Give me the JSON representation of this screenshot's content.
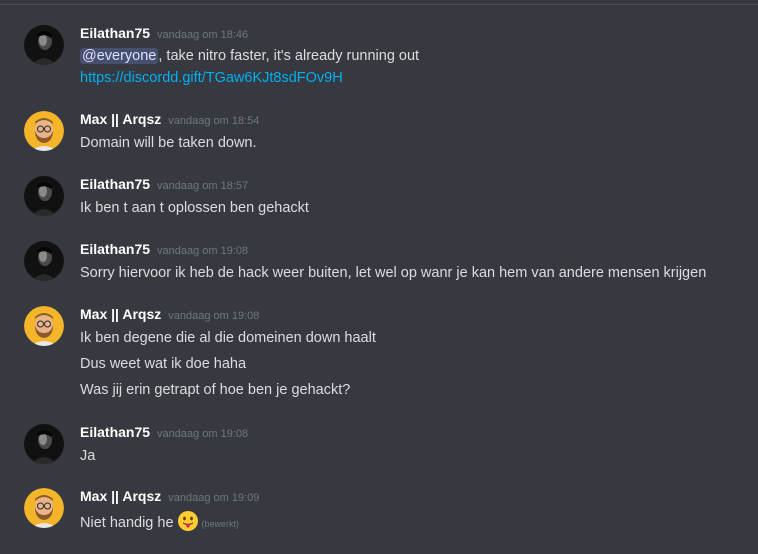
{
  "colors": {
    "background": "#36393f",
    "username": "#ffffff",
    "message_text": "#dcddde",
    "timestamp": "#72767d",
    "link": "#00b0f4",
    "mention_bg": "#4a5077"
  },
  "messages": [
    {
      "author": "Eilathan75",
      "avatar_icon": "dark-portrait-avatar",
      "timestamp": "vandaag om 18:46",
      "mention": "@everyone",
      "line1_rest": ", take nitro faster, it's already running out",
      "link": "https://discordd.gift/TGaw6KJt8sdFOv9H"
    },
    {
      "author": "Max || Arqsz",
      "avatar_icon": "cartoon-bearded-man-avatar",
      "timestamp": "vandaag om 18:54",
      "lines": [
        "Domain will be taken down."
      ]
    },
    {
      "author": "Eilathan75",
      "avatar_icon": "dark-portrait-avatar",
      "timestamp": "vandaag om 18:57",
      "lines": [
        "Ik ben t aan t oplossen ben gehackt"
      ]
    },
    {
      "author": "Eilathan75",
      "avatar_icon": "dark-portrait-avatar",
      "timestamp": "vandaag om 19:08",
      "lines": [
        "Sorry hiervoor ik heb de hack weer buiten, let wel op wanr je kan hem van andere mensen krijgen"
      ]
    },
    {
      "author": "Max || Arqsz",
      "avatar_icon": "cartoon-bearded-man-avatar",
      "timestamp": "vandaag om 19:08",
      "lines": [
        "Ik ben degene die al die domeinen down haalt",
        "Dus weet wat ik doe haha",
        "Was jij erin getrapt of hoe ben je gehackt?"
      ]
    },
    {
      "author": "Eilathan75",
      "avatar_icon": "dark-portrait-avatar",
      "timestamp": "vandaag om 19:08",
      "lines": [
        "Ja"
      ]
    },
    {
      "author": "Max || Arqsz",
      "avatar_icon": "cartoon-bearded-man-avatar",
      "timestamp": "vandaag om 19:09",
      "lines": [
        "Niet handig he"
      ],
      "emoji_icon": "tongue-out-emoji",
      "edited_label": "(bewerkt)"
    }
  ]
}
